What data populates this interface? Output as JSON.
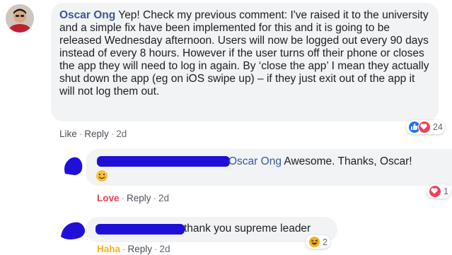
{
  "comment_main": {
    "author": "Oscar Ong",
    "text": " Yep! Check my previous comment: I've raised it to the university and a simple fix have been implemented for this and it is going to be released Wednesday afternoon. Users will now be logged out every 90 days instead of every 8 hours. However if the user turns off their phone or closes the app they will need to log in again. By ‘close the app’ I mean they actually shut down the app (eg on iOS swipe up) – if they just exit out of the app it will not log them out.",
    "actions": {
      "like": "Like",
      "reply": "Reply",
      "time": "2d"
    },
    "reaction_count": "24",
    "reaction_icons": [
      "like-icon",
      "love-icon"
    ]
  },
  "reply_1": {
    "mention": "Oscar Ong",
    "text": " Awesome. Thanks, Oscar!",
    "emoji_icon": "smile-emoji-icon",
    "actions": {
      "reaction": "Love",
      "reply": "Reply",
      "time": "2d"
    },
    "reaction_count": "1",
    "reaction_icons": [
      "love-icon"
    ]
  },
  "reply_2": {
    "text": "thank you supreme leader",
    "actions": {
      "reaction": "Haha",
      "reply": "Reply",
      "time": "2d"
    },
    "reaction_count": "2",
    "reaction_icons": [
      "haha-icon"
    ]
  },
  "colors": {
    "name_blue": "#385898",
    "bubble_bg": "#f2f3f5",
    "love_red": "#f33e58",
    "haha_yellow": "#f7b125",
    "like_blue": "#1877f2",
    "redaction": "#1f10d8"
  }
}
